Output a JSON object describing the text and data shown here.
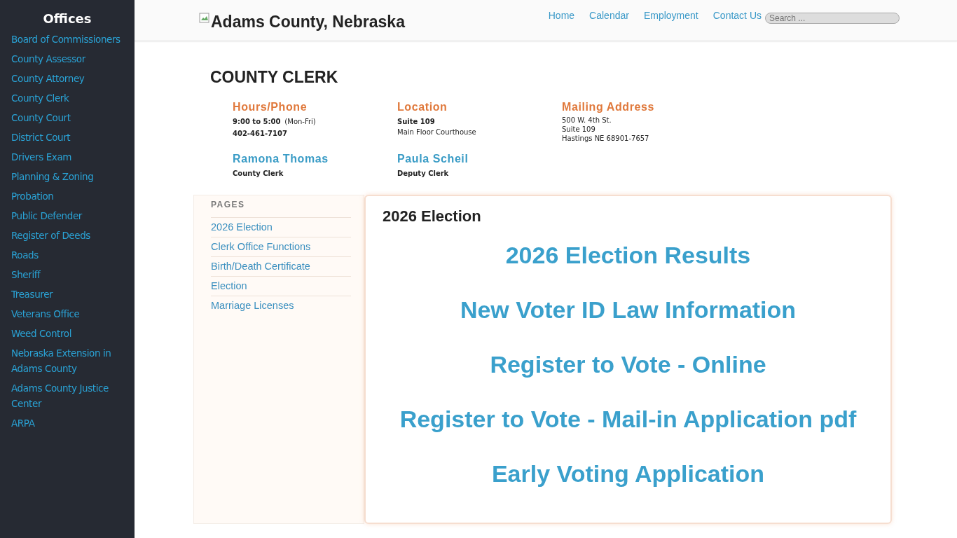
{
  "sidebar": {
    "title": "Offices",
    "items": [
      "Board of Commissioners",
      "County Assessor",
      "County Attorney",
      "County Clerk",
      "County Court",
      "District Court",
      "Drivers Exam",
      "Planning & Zoning",
      "Probation",
      "Public Defender",
      "Register of Deeds",
      "Roads",
      "Sheriff",
      "Treasurer",
      "Veterans Office",
      "Weed Control",
      "Nebraska Extension in Adams County",
      "Adams County Justice Center",
      "ARPA"
    ]
  },
  "header": {
    "site_title": "Adams County, Nebraska",
    "nav": [
      "Home",
      "Calendar",
      "Employment",
      "Contact Us"
    ],
    "search": {
      "placeholder": "Search ..."
    }
  },
  "page_title": "COUNTY CLERK",
  "info": [
    {
      "heading": "Hours/Phone",
      "lines": [
        {
          "text": "9:00 to 5:00",
          "bold": true,
          "note": "(Mon-Fri)"
        },
        {
          "text": "402-461-7107",
          "bold": true
        }
      ]
    },
    {
      "heading": "Location",
      "lines": [
        {
          "text": "Suite 109",
          "bold": true
        },
        {
          "text": "Main Floor Courthouse",
          "bold": false
        }
      ]
    },
    {
      "heading": "Mailing Address",
      "lines": [
        {
          "text": "500 W. 4th St.",
          "bold": false
        },
        {
          "text": "Suite 109",
          "bold": false
        },
        {
          "text": "Hastings NE 68901-7657",
          "bold": false
        }
      ]
    }
  ],
  "staff": [
    {
      "name": "Ramona Thomas",
      "role": "County Clerk"
    },
    {
      "name": "Paula Scheil",
      "role": "Deputy Clerk"
    }
  ],
  "pages": {
    "heading": "PAGES",
    "items": [
      "2026 Election",
      "Clerk Office Functions",
      "Birth/Death Certificate",
      "Election",
      "Marriage Licenses"
    ]
  },
  "content": {
    "title": "2026 Election",
    "links": [
      "2026 Election Results",
      "New Voter ID Law Information",
      "Register to Vote - Online",
      "Register to Vote - Mail-in Application pdf",
      "Early Voting Application"
    ]
  }
}
